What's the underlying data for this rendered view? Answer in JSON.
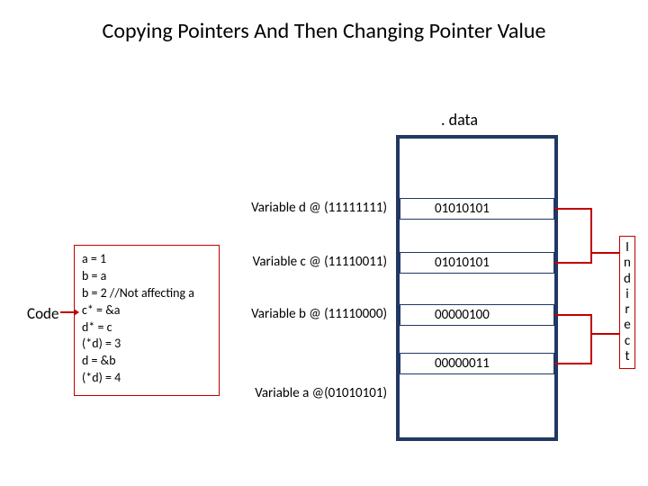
{
  "title": "Copying Pointers And Then Changing Pointer Value",
  "data_section_label": ". data",
  "variables": {
    "d": {
      "label": "Variable d @ (11111111)",
      "value": "01010101"
    },
    "c": {
      "label": "Variable c @ (11110011)",
      "value": "01010101"
    },
    "b": {
      "label": "Variable b @ (11110000)",
      "value": "00000100"
    },
    "a": {
      "label": "Variable a @(01010101)",
      "value": "00000011"
    }
  },
  "code_label": "Code",
  "code_lines": [
    "a = 1",
    "b = a",
    "b = 2 //Not affecting a",
    "c* = &a",
    "d* = c",
    "(*d) = 3",
    "d = &b",
    "(*d) = 4"
  ],
  "indirect_label": [
    "I",
    "n",
    "d",
    "i",
    "r",
    "e",
    "c",
    "t"
  ]
}
